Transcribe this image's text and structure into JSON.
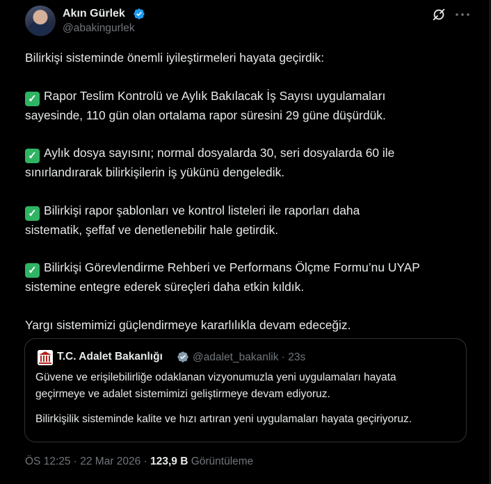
{
  "author": {
    "name": "Akın Gürlek",
    "handle": "@abakingurlek"
  },
  "icons": {
    "verified": "verified-badge-icon",
    "grok": "grok-icon",
    "more": "more-options-icon",
    "check": "check-mark-icon"
  },
  "colors": {
    "verified_blue": "#1d9bf0",
    "check_green": "#2fb463",
    "muted": "#71767b",
    "text": "#e7e9ea",
    "border": "#2f3336"
  },
  "tweet": {
    "intro": "Bilirkişi sisteminde önemli iyileştirmeleri hayata geçirdik:",
    "p1_l1": "Rapor Teslim Kontrolü ve Aylık Bakılacak İş Sayısı uygulamaları",
    "p1_l2": "sayesinde, 110 gün olan ortalama rapor süresini 29 güne düşürdük.",
    "p2_l1": "Aylık dosya sayısını; normal dosyalarda 30, seri dosyalarda 60 ile",
    "p2_l2": "sınırlandırarak bilirkişilerin iş yükünü dengeledik.",
    "p3_l1": "Bilirkişi rapor şablonları ve kontrol listeleri ile raporları daha",
    "p3_l2": "sistematik, şeffaf ve denetlenebilir hale getirdik.",
    "p4_l1": "Bilirkişi Görevlendirme Rehberi ve Performans Ölçme Formu’nu UYAP",
    "p4_l2": "sistemine entegre ederek süreçleri daha etkin kıldık.",
    "outro": "Yargı sistemimizi güçlendirmeye kararlılıkla devam edeceğiz."
  },
  "quote": {
    "name": "T.C. Adalet Bakanlığı",
    "handle_time": "@adalet_bakanlik · 23s",
    "l1": "Güvene ve erişilebilirliğe odaklanan vizyonumuzla yeni uygulamaları hayata",
    "l2": "geçirmeye ve adalet sistemimizi geliştirmeye devam ediyoruz.",
    "l3": "Bilirkişilik sisteminde kalite ve hızı artıran yeni uygulamaları hayata geçiriyoruz."
  },
  "meta": {
    "timestamp": "ÖS 12:25 · 22 Mar 2026",
    "separator": "·",
    "views_count": "123,9 B",
    "views_label": "Görüntüleme"
  }
}
